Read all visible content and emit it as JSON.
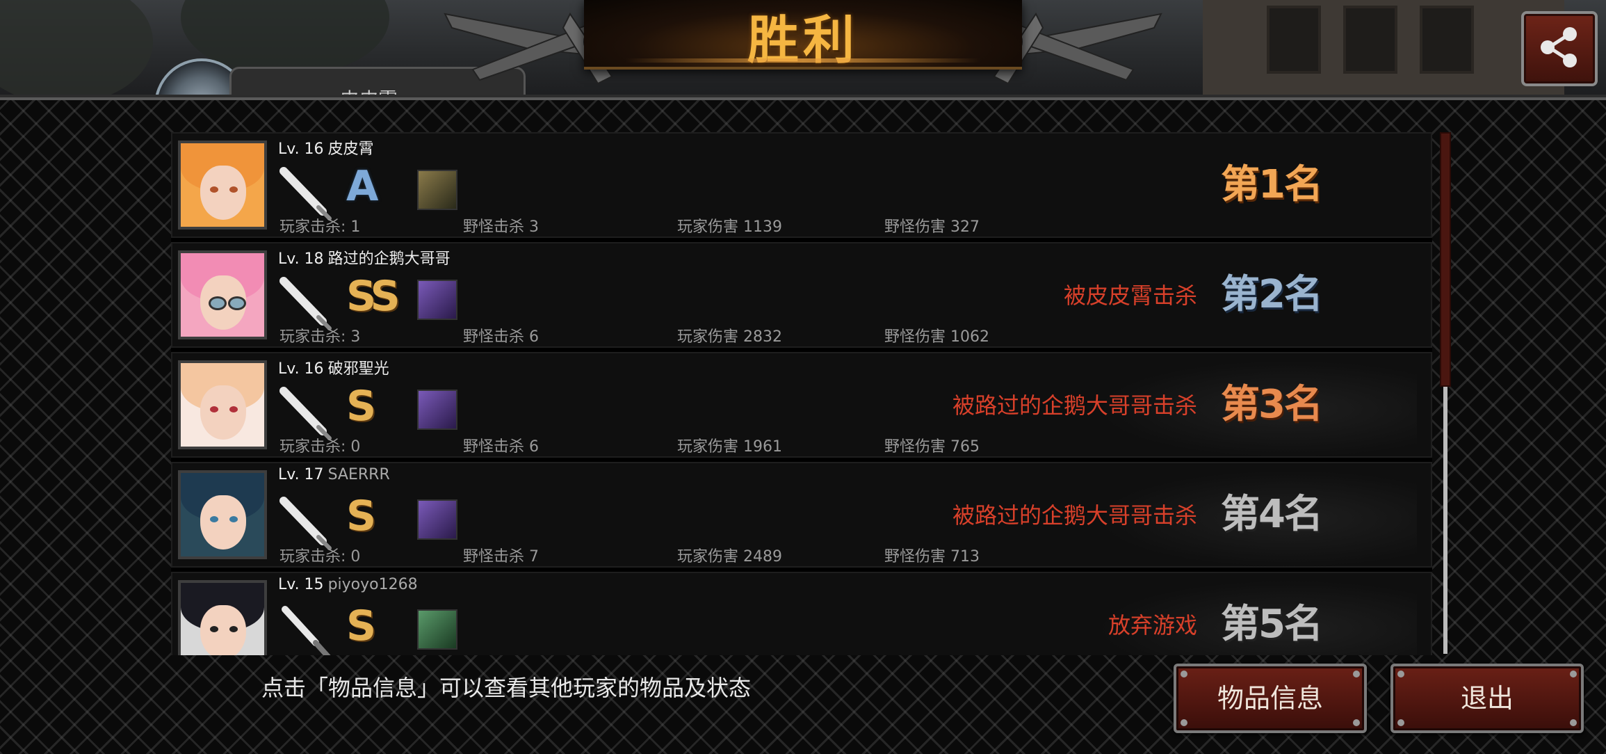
{
  "header": {
    "title": "胜利",
    "partial_tab_text": "皮皮霄"
  },
  "players": [
    {
      "level": "Lv. 16",
      "name": "皮皮霄",
      "grade": "A",
      "status": "",
      "rank": "第1名",
      "stats": {
        "player_kills": "玩家击杀: 1",
        "monster_kills": "野怪击杀 3",
        "player_damage": "玩家伤害 1139",
        "monster_damage": "野怪伤害 327"
      }
    },
    {
      "level": "Lv. 18",
      "name": "路过的企鹅大哥哥",
      "grade": "SS",
      "status": "被皮皮霄击杀",
      "rank": "第2名",
      "stats": {
        "player_kills": "玩家击杀: 3",
        "monster_kills": "野怪击杀 6",
        "player_damage": "玩家伤害 2832",
        "monster_damage": "野怪伤害 1062"
      }
    },
    {
      "level": "Lv. 16",
      "name": "破邪聖光",
      "grade": "S",
      "status": "被路过的企鹅大哥哥击杀",
      "rank": "第3名",
      "stats": {
        "player_kills": "玩家击杀: 0",
        "monster_kills": "野怪击杀 6",
        "player_damage": "玩家伤害 1961",
        "monster_damage": "野怪伤害 765"
      }
    },
    {
      "level": "Lv. 17",
      "name": "SAERRR",
      "grade": "S",
      "status": "被路过的企鹅大哥哥击杀",
      "rank": "第4名",
      "stats": {
        "player_kills": "玩家击杀: 0",
        "monster_kills": "野怪击杀 7",
        "player_damage": "玩家伤害 2489",
        "monster_damage": "野怪伤害 713"
      }
    },
    {
      "level": "Lv. 15",
      "name": "piyoyo1268",
      "grade": "S",
      "status": "放弃游戏",
      "rank": "第5名"
    }
  ],
  "footer": {
    "hint": "点击「物品信息」可以查看其他玩家的物品及状态",
    "item_info_button": "物品信息",
    "exit_button": "退出"
  },
  "icons": {
    "share": "share-icon",
    "weapon": "bat-icon",
    "item": "item-thumbnail"
  },
  "colors": {
    "title": "#f5b642",
    "kill_text": "#d8402a",
    "rank_1": "#f2a655",
    "rank_2": "#9ab4cf",
    "rank_3": "#e88a4e",
    "button_bg": "#6a2016"
  }
}
